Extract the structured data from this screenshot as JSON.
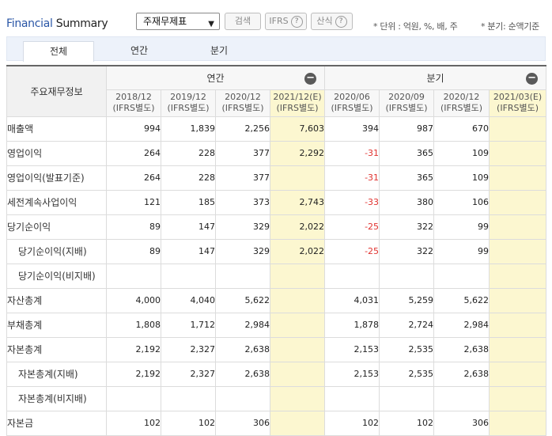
{
  "header": {
    "title_part1": "Financial",
    "title_part2": "Summary",
    "select_value": "주재무제표",
    "search_button": "검색",
    "ifrs_button": "IFRS",
    "formula_button": "산식",
    "help_glyph": "?",
    "unit_note": "* 단위 : 억원, %, 배, 주",
    "quarter_note": "* 분기: 순액기준"
  },
  "tabs": [
    "전체",
    "연간",
    "분기"
  ],
  "active_tab": "전체",
  "table": {
    "corner_label": "주요재무정보",
    "annual_group": "연간",
    "quarter_group": "분기",
    "collapse_glyph": "−",
    "annual_periods": [
      {
        "date": "2018/12",
        "basis": "(IFRS별도)"
      },
      {
        "date": "2019/12",
        "basis": "(IFRS별도)"
      },
      {
        "date": "2020/12",
        "basis": "(IFRS별도)"
      },
      {
        "date": "2021/12(E)",
        "basis": "(IFRS별도)"
      }
    ],
    "quarter_periods": [
      {
        "date": "2020/06",
        "basis": "(IFRS별도)"
      },
      {
        "date": "2020/09",
        "basis": "(IFRS별도)"
      },
      {
        "date": "2020/12",
        "basis": "(IFRS별도)"
      },
      {
        "date": "2021/03(E)",
        "basis": "(IFRS별도)"
      }
    ],
    "rows": [
      {
        "label": "매출액",
        "sub": false,
        "values": [
          "994",
          "1,839",
          "2,256",
          "7,603",
          "394",
          "987",
          "670",
          ""
        ]
      },
      {
        "label": "영업이익",
        "sub": false,
        "values": [
          "264",
          "228",
          "377",
          "2,292",
          "-31",
          "365",
          "109",
          ""
        ]
      },
      {
        "label": "영업이익(발표기준)",
        "sub": false,
        "values": [
          "264",
          "228",
          "377",
          "",
          "-31",
          "365",
          "109",
          ""
        ]
      },
      {
        "label": "세전계속사업이익",
        "sub": false,
        "values": [
          "121",
          "185",
          "373",
          "2,743",
          "-33",
          "380",
          "106",
          ""
        ]
      },
      {
        "label": "당기순이익",
        "sub": false,
        "values": [
          "89",
          "147",
          "329",
          "2,022",
          "-25",
          "322",
          "99",
          ""
        ]
      },
      {
        "label": "당기순이익(지배)",
        "sub": true,
        "values": [
          "89",
          "147",
          "329",
          "2,022",
          "-25",
          "322",
          "99",
          ""
        ]
      },
      {
        "label": "당기순이익(비지배)",
        "sub": true,
        "values": [
          "",
          "",
          "",
          "",
          "",
          "",
          "",
          ""
        ]
      },
      {
        "label": "자산총계",
        "sub": false,
        "values": [
          "4,000",
          "4,040",
          "5,622",
          "",
          "4,031",
          "5,259",
          "5,622",
          ""
        ]
      },
      {
        "label": "부채총계",
        "sub": false,
        "values": [
          "1,808",
          "1,712",
          "2,984",
          "",
          "1,878",
          "2,724",
          "2,984",
          ""
        ]
      },
      {
        "label": "자본총계",
        "sub": false,
        "values": [
          "2,192",
          "2,327",
          "2,638",
          "",
          "2,153",
          "2,535",
          "2,638",
          ""
        ]
      },
      {
        "label": "자본총계(지배)",
        "sub": true,
        "values": [
          "2,192",
          "2,327",
          "2,638",
          "",
          "2,153",
          "2,535",
          "2,638",
          ""
        ]
      },
      {
        "label": "자본총계(비지배)",
        "sub": true,
        "values": [
          "",
          "",
          "",
          "",
          "",
          "",
          "",
          ""
        ]
      },
      {
        "label": "자본금",
        "sub": false,
        "values": [
          "102",
          "102",
          "306",
          "",
          "102",
          "102",
          "306",
          ""
        ]
      }
    ]
  }
}
